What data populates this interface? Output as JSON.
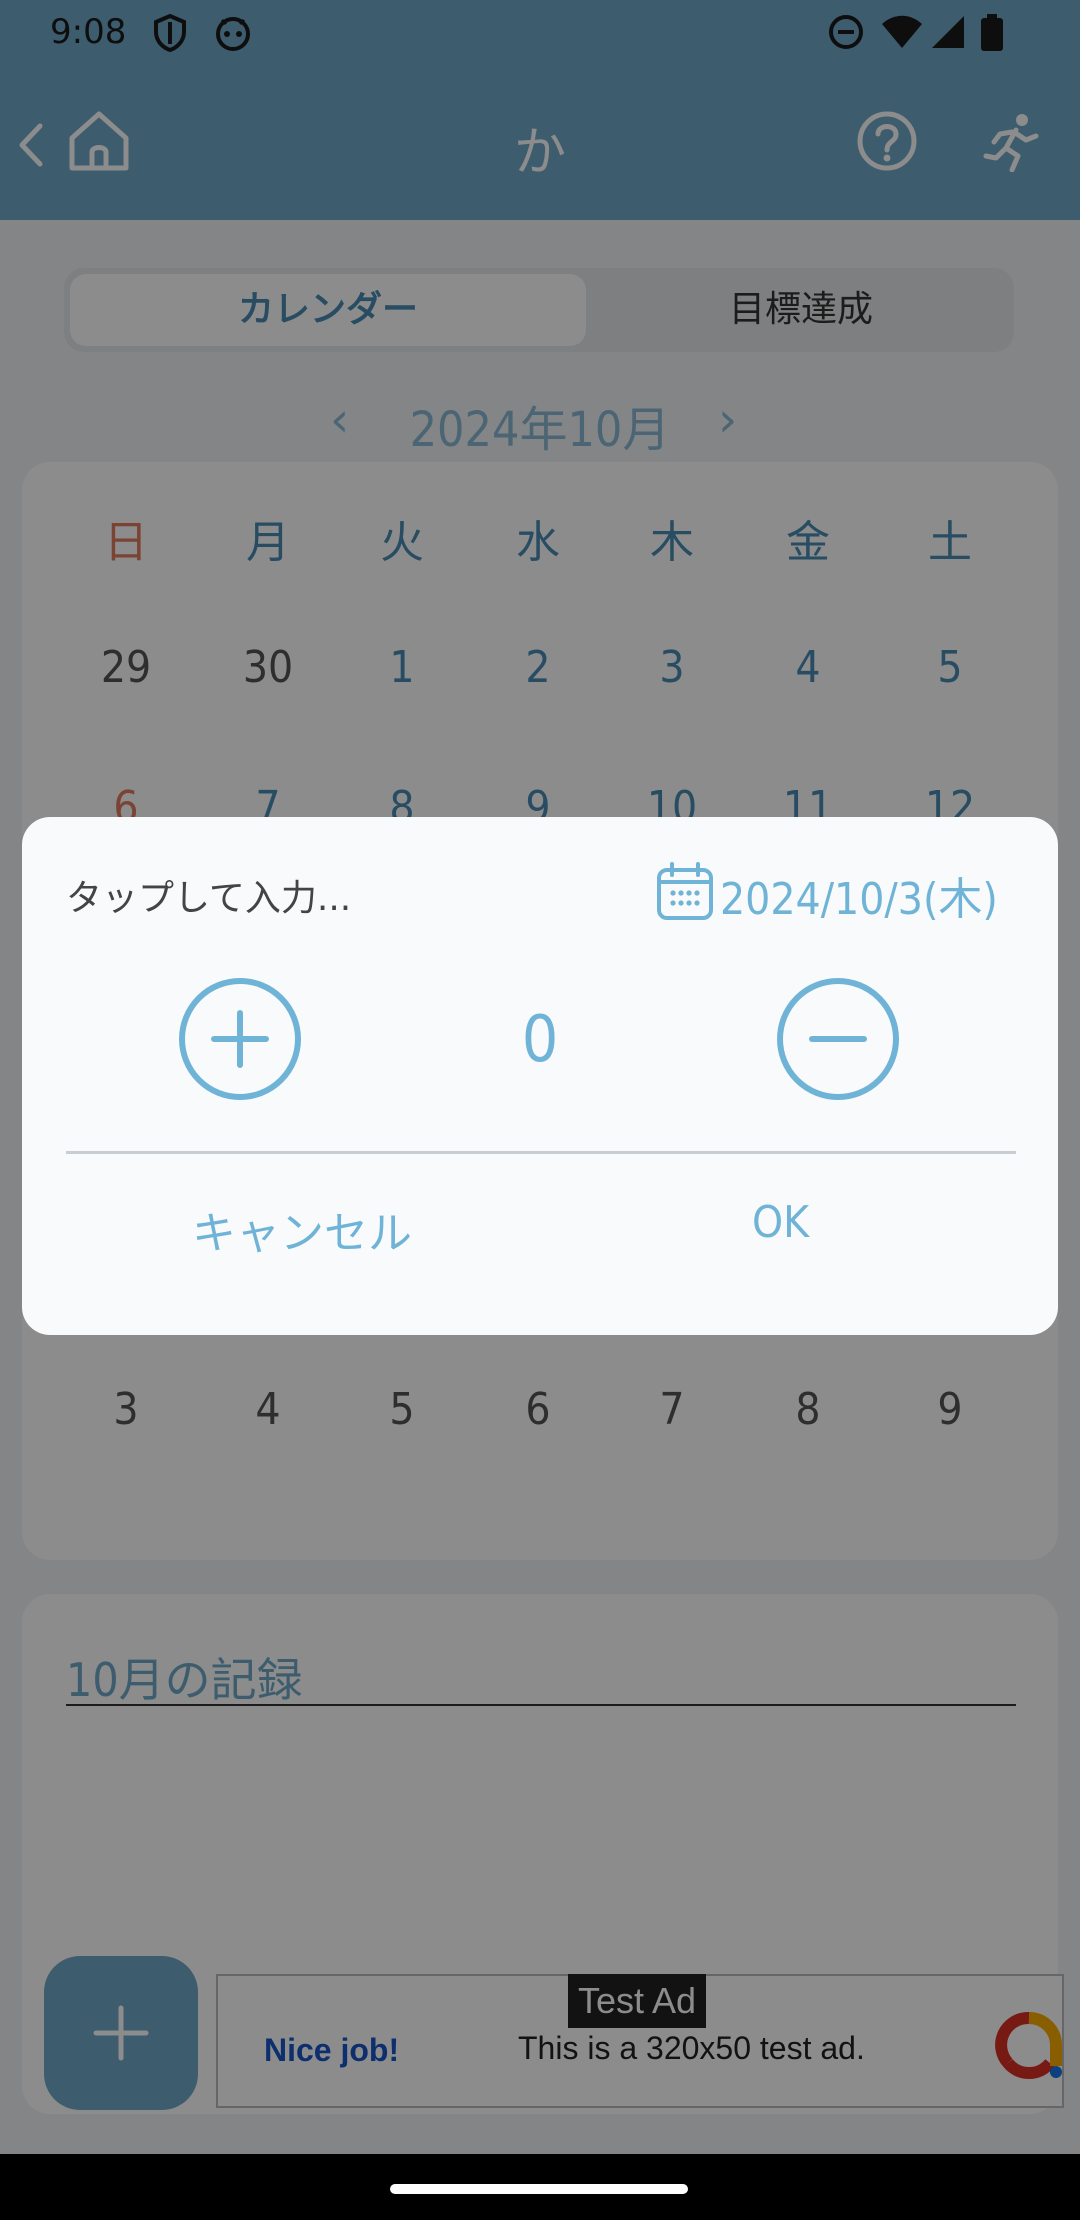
{
  "status_bar": {
    "time": "9:08"
  },
  "app_bar": {
    "title": "か"
  },
  "tabs": {
    "active": "カレンダー",
    "inactive": "目標達成"
  },
  "month_nav": {
    "label": "2024年10月",
    "prev": "‹",
    "next": "›"
  },
  "calendar": {
    "weekdays": [
      "日",
      "月",
      "火",
      "水",
      "木",
      "金",
      "土"
    ],
    "rows": [
      [
        "29",
        "30",
        "1",
        "2",
        "3",
        "4",
        "5"
      ],
      [
        "6",
        "7",
        "8",
        "9",
        "10",
        "11",
        "12"
      ],
      [
        "3",
        "4",
        "5",
        "6",
        "7",
        "8",
        "9"
      ]
    ]
  },
  "records": {
    "title": "10月の記録"
  },
  "ad": {
    "tag": "Test Ad",
    "left": "Nice job!",
    "main": "This is a 320x50 test ad."
  },
  "dialog": {
    "placeholder": "タップして入力...",
    "date": "2024/10/3(木)",
    "count": "0",
    "cancel": "キャンセル",
    "ok": "OK"
  },
  "colors": {
    "accent": "#6fb4d6",
    "appbar": "#6fa9c9",
    "sunday": "#e07a5f"
  }
}
